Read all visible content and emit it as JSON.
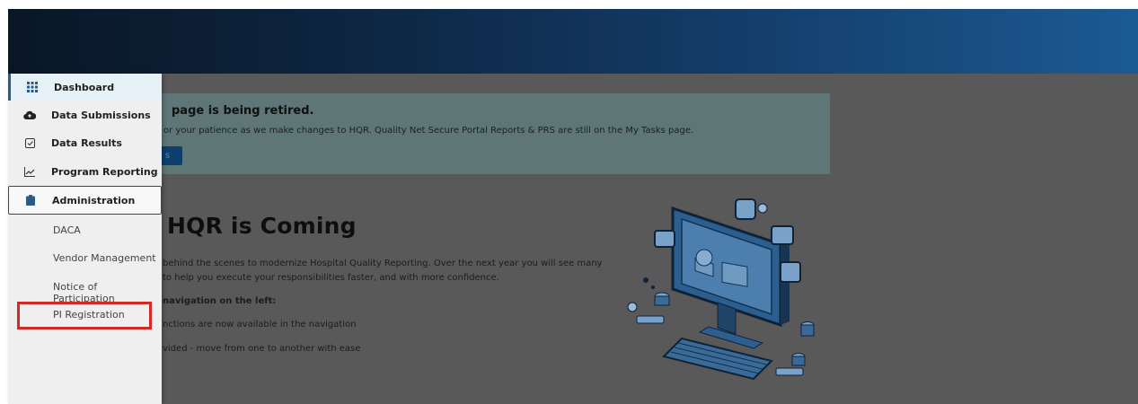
{
  "banner": {
    "title": "page is being retired.",
    "text": "or your patience as we make changes to HQR. Quality Net Secure Portal Reports & PRS are still on the My Tasks page.",
    "button_label": "s"
  },
  "main": {
    "heading": "HQR is Coming",
    "line1": "behind the scenes to modernize Hospital Quality Reporting. Over the next year you will see many",
    "line2": "to help you execute your responsibilities faster, and with more confidence.",
    "subheading": "navigation on the left:",
    "bullet1": "nctions are now available in the navigation",
    "bullet2": "vided - move from one to another with ease"
  },
  "sidebar": {
    "items": [
      {
        "label": "Dashboard",
        "icon": "grid-icon"
      },
      {
        "label": "Data Submissions",
        "icon": "cloud-upload-icon"
      },
      {
        "label": "Data Results",
        "icon": "checkbox-icon"
      },
      {
        "label": "Program Reporting",
        "icon": "line-chart-icon"
      },
      {
        "label": "Administration",
        "icon": "clipboard-icon"
      }
    ],
    "subitems": [
      {
        "label": "DACA"
      },
      {
        "label": "Vendor Management"
      },
      {
        "label": "Notice of Participation"
      },
      {
        "label": "PI Registration"
      }
    ]
  },
  "colors": {
    "accent": "#0c3f6e",
    "highlight": "#d12a2a"
  }
}
